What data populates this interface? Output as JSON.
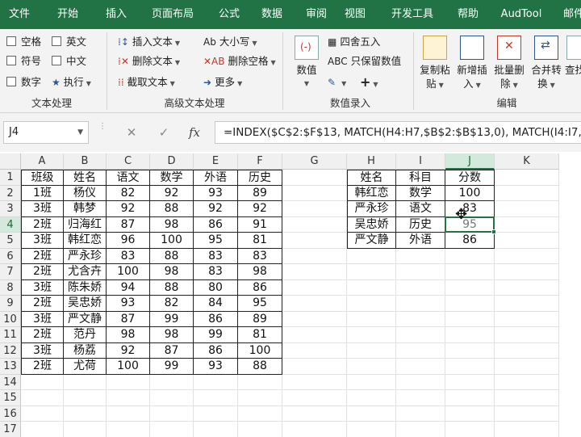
{
  "ribbon_tabs": [
    "文件",
    "开始",
    "插入",
    "页面布局",
    "公式",
    "数据",
    "审阅",
    "视图",
    "开发工具",
    "帮助",
    "AudTool",
    "邮件"
  ],
  "ribbon": {
    "text_group": {
      "label": "文本处理",
      "items": [
        "空格",
        "英文",
        "符号",
        "中文",
        "数字",
        "执行"
      ]
    },
    "adv_group": {
      "label": "高级文本处理",
      "insert_text": "插入文本",
      "delete_text": "删除文本",
      "truncate_text": "截取文本",
      "case": "大小写",
      "delete_space": "删除空格",
      "more": "更多"
    },
    "num_group": {
      "label": "数值录入",
      "number": "数值",
      "round": "四舍五入",
      "keep_value": "只保留数值"
    },
    "edit_group": {
      "label": "编辑",
      "copy_paste_1": "复制粘",
      "copy_paste_2": "贴",
      "add_insert_1": "新增插",
      "add_insert_2": "入",
      "batch_delete_1": "批量删",
      "batch_delete_2": "除",
      "merge_1": "合并转",
      "merge_2": "换",
      "find_1": "查找"
    }
  },
  "formula_bar": {
    "name_box": "J4",
    "cancel": "✕",
    "enter": "✓",
    "fx": "fx",
    "formula": "=INDEX($C$2:$F$13, MATCH(H4:H7,$B$2:$B$13,0),  MATCH(I4:I7,$C$1:$F$1,0))"
  },
  "columns": [
    "A",
    "B",
    "C",
    "D",
    "E",
    "F",
    "G",
    "H",
    "I",
    "J",
    "K"
  ],
  "rows": [
    "1",
    "2",
    "3",
    "4",
    "5",
    "6",
    "7",
    "8",
    "9",
    "10",
    "11",
    "12",
    "13",
    "14",
    "15",
    "16",
    "17"
  ],
  "main_table": [
    [
      "班级",
      "姓名",
      "语文",
      "数学",
      "外语",
      "历史"
    ],
    [
      "1班",
      "杨仪",
      "82",
      "92",
      "93",
      "89"
    ],
    [
      "3班",
      "韩梦",
      "92",
      "88",
      "92",
      "92"
    ],
    [
      "2班",
      "归海红",
      "87",
      "98",
      "86",
      "91"
    ],
    [
      "3班",
      "韩红恋",
      "96",
      "100",
      "95",
      "81"
    ],
    [
      "2班",
      "严永珍",
      "83",
      "88",
      "83",
      "83"
    ],
    [
      "2班",
      "尤含卉",
      "100",
      "98",
      "83",
      "98"
    ],
    [
      "3班",
      "陈朱娇",
      "94",
      "88",
      "80",
      "86"
    ],
    [
      "2班",
      "吴忠娇",
      "93",
      "82",
      "84",
      "95"
    ],
    [
      "3班",
      "严文静",
      "87",
      "99",
      "86",
      "89"
    ],
    [
      "2班",
      "范丹",
      "98",
      "98",
      "99",
      "81"
    ],
    [
      "3班",
      "杨荔",
      "92",
      "87",
      "86",
      "100"
    ],
    [
      "2班",
      "尤荷",
      "100",
      "99",
      "93",
      "88"
    ]
  ],
  "lookup_table": [
    [
      "姓名",
      "科目",
      "分数"
    ],
    [
      "韩红恋",
      "数学",
      "100"
    ],
    [
      "严永珍",
      "语文",
      "83"
    ],
    [
      "吴忠娇",
      "历史",
      "95"
    ],
    [
      "严文静",
      "外语",
      "86"
    ]
  ],
  "colors": {
    "accent": "#217346",
    "ribbon_bg": "#f3f3f3"
  },
  "icons": [
    "name-box-dropdown-icon",
    "cancel-icon",
    "enter-icon",
    "fx-icon",
    "cursor-icon"
  ]
}
